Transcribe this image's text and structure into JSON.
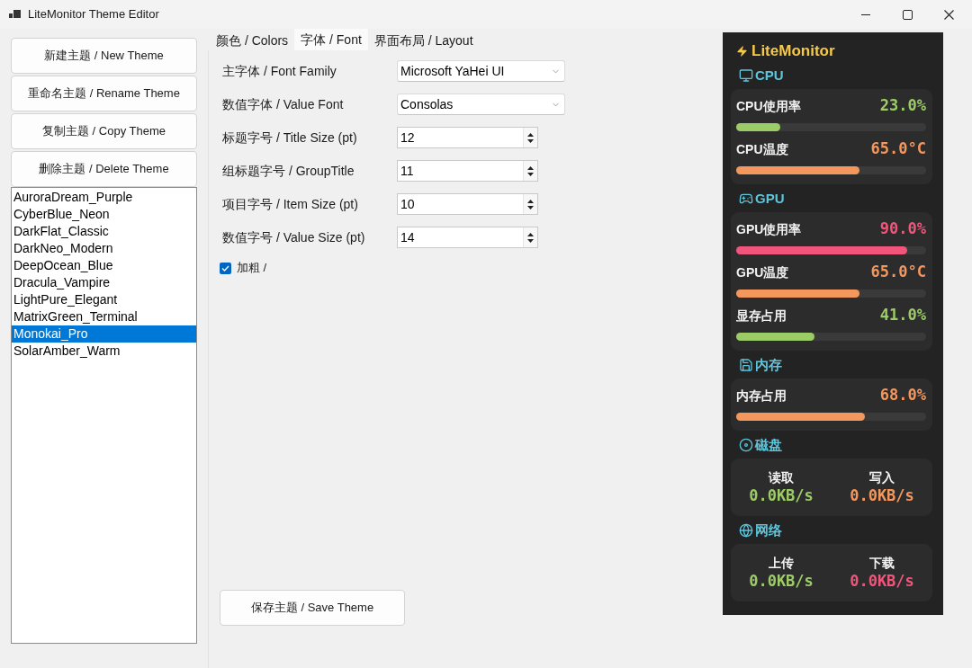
{
  "window": {
    "title": "LiteMonitor Theme Editor"
  },
  "sidebar": {
    "buttons": [
      "新建主题 / New Theme",
      "重命名主题 / Rename Theme",
      "复制主题 / Copy Theme",
      "删除主题 / Delete Theme"
    ],
    "themes": [
      {
        "label": "AuroraDream_Purple",
        "selected": false
      },
      {
        "label": "CyberBlue_Neon",
        "selected": false
      },
      {
        "label": "DarkFlat_Classic",
        "selected": false
      },
      {
        "label": "DarkNeo_Modern",
        "selected": false
      },
      {
        "label": "DeepOcean_Blue",
        "selected": false
      },
      {
        "label": "Dracula_Vampire",
        "selected": false
      },
      {
        "label": "LightPure_Elegant",
        "selected": false
      },
      {
        "label": "MatrixGreen_Terminal",
        "selected": false
      },
      {
        "label": "Monokai_Pro",
        "selected": true
      },
      {
        "label": "SolarAmber_Warm",
        "selected": false
      }
    ]
  },
  "tabs": [
    {
      "label": "颜色 / Colors",
      "selected": false
    },
    {
      "label": "字体 / Font",
      "selected": true
    },
    {
      "label": "界面布局 / Layout",
      "selected": false
    }
  ],
  "font_tab": {
    "fields": [
      {
        "kind": "dropdown",
        "label": "主字体 / Font Family",
        "value": "Microsoft YaHei UI"
      },
      {
        "kind": "dropdown",
        "label": "数值字体 / Value Font",
        "value": "Consolas"
      },
      {
        "kind": "spinner",
        "label": "标题字号 / Title Size (pt)",
        "value": "12"
      },
      {
        "kind": "spinner",
        "label": "组标题字号 / GroupTitle",
        "value": "11"
      },
      {
        "kind": "spinner",
        "label": "项目字号 / Item Size (pt)",
        "value": "10"
      },
      {
        "kind": "spinner",
        "label": "数值字号 / Value Size (pt)",
        "value": "14"
      }
    ],
    "bold_checkbox": {
      "label": "加粗 /",
      "checked": true
    },
    "save_button": "保存主题 / Save Theme"
  },
  "preview": {
    "title": "LiteMonitor",
    "groups": [
      {
        "kind": "bars",
        "title": "CPU",
        "items": [
          {
            "label": "CPU使用率",
            "value": "23.0%",
            "level": 0.23,
            "color": "#9ccc65"
          },
          {
            "label": "CPU温度",
            "value": "65.0°C",
            "level": 0.65,
            "color": "#f4975c"
          }
        ]
      },
      {
        "kind": "bars",
        "title": "GPU",
        "items": [
          {
            "label": "GPU使用率",
            "value": "90.0%",
            "level": 0.9,
            "color": "#f2557b"
          },
          {
            "label": "GPU温度",
            "value": "65.0°C",
            "level": 0.65,
            "color": "#f4975c"
          },
          {
            "label": "显存占用",
            "value": "41.0%",
            "level": 0.41,
            "color": "#9ccc65"
          }
        ]
      },
      {
        "kind": "bars",
        "title": "内存",
        "items": [
          {
            "label": "内存占用",
            "value": "68.0%",
            "level": 0.68,
            "color": "#f4975c"
          }
        ]
      },
      {
        "kind": "columns",
        "title": "磁盘",
        "items": [
          {
            "label": "读取",
            "value": "0.0KB/s",
            "color": "#9ccc65"
          },
          {
            "label": "写入",
            "value": "0.0KB/s",
            "color": "#f4975c"
          }
        ]
      },
      {
        "kind": "columns",
        "title": "网络",
        "items": [
          {
            "label": "上传",
            "value": "0.0KB/s",
            "color": "#9ccc65"
          },
          {
            "label": "下载",
            "value": "0.0KB/s",
            "color": "#f2557b"
          }
        ]
      }
    ]
  }
}
